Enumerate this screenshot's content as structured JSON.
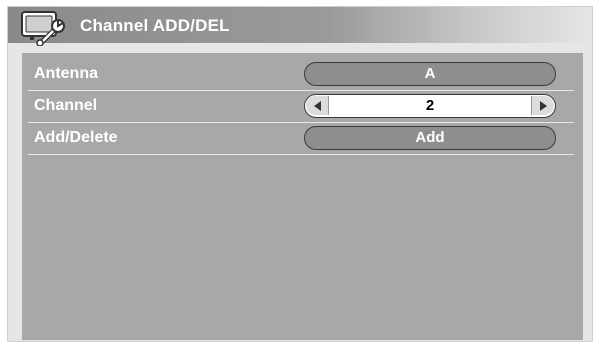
{
  "window": {
    "title": "Channel ADD/DEL",
    "title_icon": "tv-wrench-icon"
  },
  "settings": [
    {
      "label": "Antenna",
      "value": "A"
    },
    {
      "label": "Channel",
      "value": "2",
      "control": "selector"
    },
    {
      "label": "Add/Delete",
      "value": "Add"
    }
  ],
  "colors": {
    "panel": "#a8a8a8",
    "pill": "#8e8e8e",
    "selector_bg": "#ffffff",
    "text": "#ffffff"
  }
}
